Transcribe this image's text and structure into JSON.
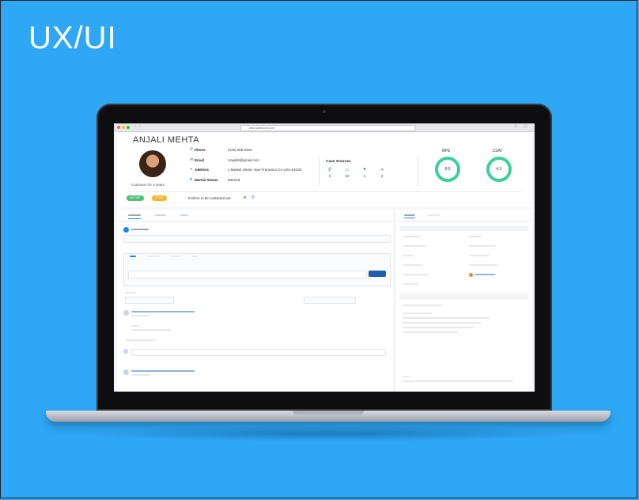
{
  "brand": {
    "title": "UX/UI"
  },
  "browser": {
    "url": "www.salesforce.com"
  },
  "profile": {
    "name": "ANJALI MEHTA",
    "customer_for": "Customer for 4 years",
    "fields": {
      "phone_label": "Phone",
      "phone": "(415) 555 9303",
      "email_label": "Email",
      "email": "AnjaliM@gmail.com",
      "address_label": "Address",
      "address": "1 Market Street, San Francisco CA USA 94105",
      "marital_label": "Marital Status",
      "marital": "Married"
    },
    "badges": {
      "active": "ACTIVE",
      "gold": "GOLD"
    },
    "prefers_label": "Prefers to be contacted via"
  },
  "case_sources": {
    "title": "Case Sources",
    "items": [
      {
        "icon": "phone-icon",
        "count": "3"
      },
      {
        "icon": "monitor-icon",
        "count": "10"
      },
      {
        "icon": "chat-icon",
        "count": "1"
      },
      {
        "icon": "share-icon",
        "count": "2"
      }
    ]
  },
  "metrics": {
    "nps_label": "NPS",
    "nps_value": "8.0",
    "csat_label": "CSAT",
    "csat_value": "4.3"
  },
  "colors": {
    "background": "#2ea7f5",
    "active_badge": "#4bc076",
    "gold_badge": "#f4b32b",
    "ring": "#3ecf9a",
    "accent": "#1f5fae"
  }
}
